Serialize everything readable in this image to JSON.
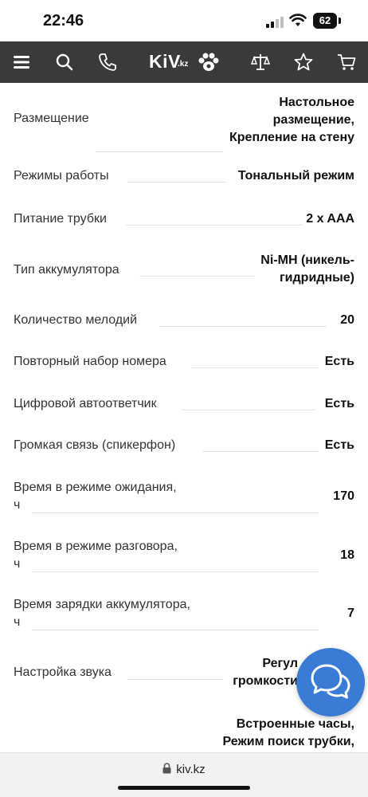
{
  "status_bar": {
    "time": "22:46",
    "battery": "62"
  },
  "nav": {
    "logo_main": "KiV",
    "logo_suffix": ".kz",
    "icons": [
      "menu-icon",
      "search-icon",
      "phone-icon",
      "compare-icon",
      "favorites-icon",
      "cart-icon"
    ]
  },
  "specs": [
    {
      "label": "Размещение",
      "value_lines": [
        "Настольное",
        "размещение,",
        "Крепление на стену"
      ]
    },
    {
      "label": "Режимы работы",
      "value_lines": [
        "Тональный режим"
      ]
    },
    {
      "label": "Питание трубки",
      "value_lines": [
        "2 x AAA"
      ]
    },
    {
      "label": "Тип аккумулятора",
      "value_lines": [
        "Ni-MH (никель-",
        "гидридные)"
      ]
    },
    {
      "label": "Количество мелодий",
      "value_lines": [
        "20"
      ]
    },
    {
      "label": "Повторный набор номера",
      "value_lines": [
        "Есть"
      ]
    },
    {
      "label": "Цифровой автоответчик",
      "value_lines": [
        "Есть"
      ]
    },
    {
      "label": "Громкая связь (спикерфон)",
      "value_lines": [
        "Есть"
      ]
    },
    {
      "label_lines": [
        "Время в режиме ожидания,",
        "ч"
      ],
      "value_lines": [
        "170"
      ]
    },
    {
      "label_lines": [
        "Время в режиме разговора,",
        "ч"
      ],
      "value_lines": [
        "18"
      ]
    },
    {
      "label_lines": [
        "Время зарядки аккумулятора,",
        "ч"
      ],
      "value_lines": [
        "7"
      ]
    },
    {
      "label": "Настройка звука",
      "value_lines": [
        "Регул",
        "громкости"
      ]
    },
    {
      "label": "",
      "value_lines": [
        "Встроенные часы,",
        "Режим поиск трубки,"
      ]
    }
  ],
  "browser": {
    "url": "kiv.kz"
  },
  "colors": {
    "nav_bg": "#3a3a3a",
    "chat_button": "#3a7bd5"
  }
}
